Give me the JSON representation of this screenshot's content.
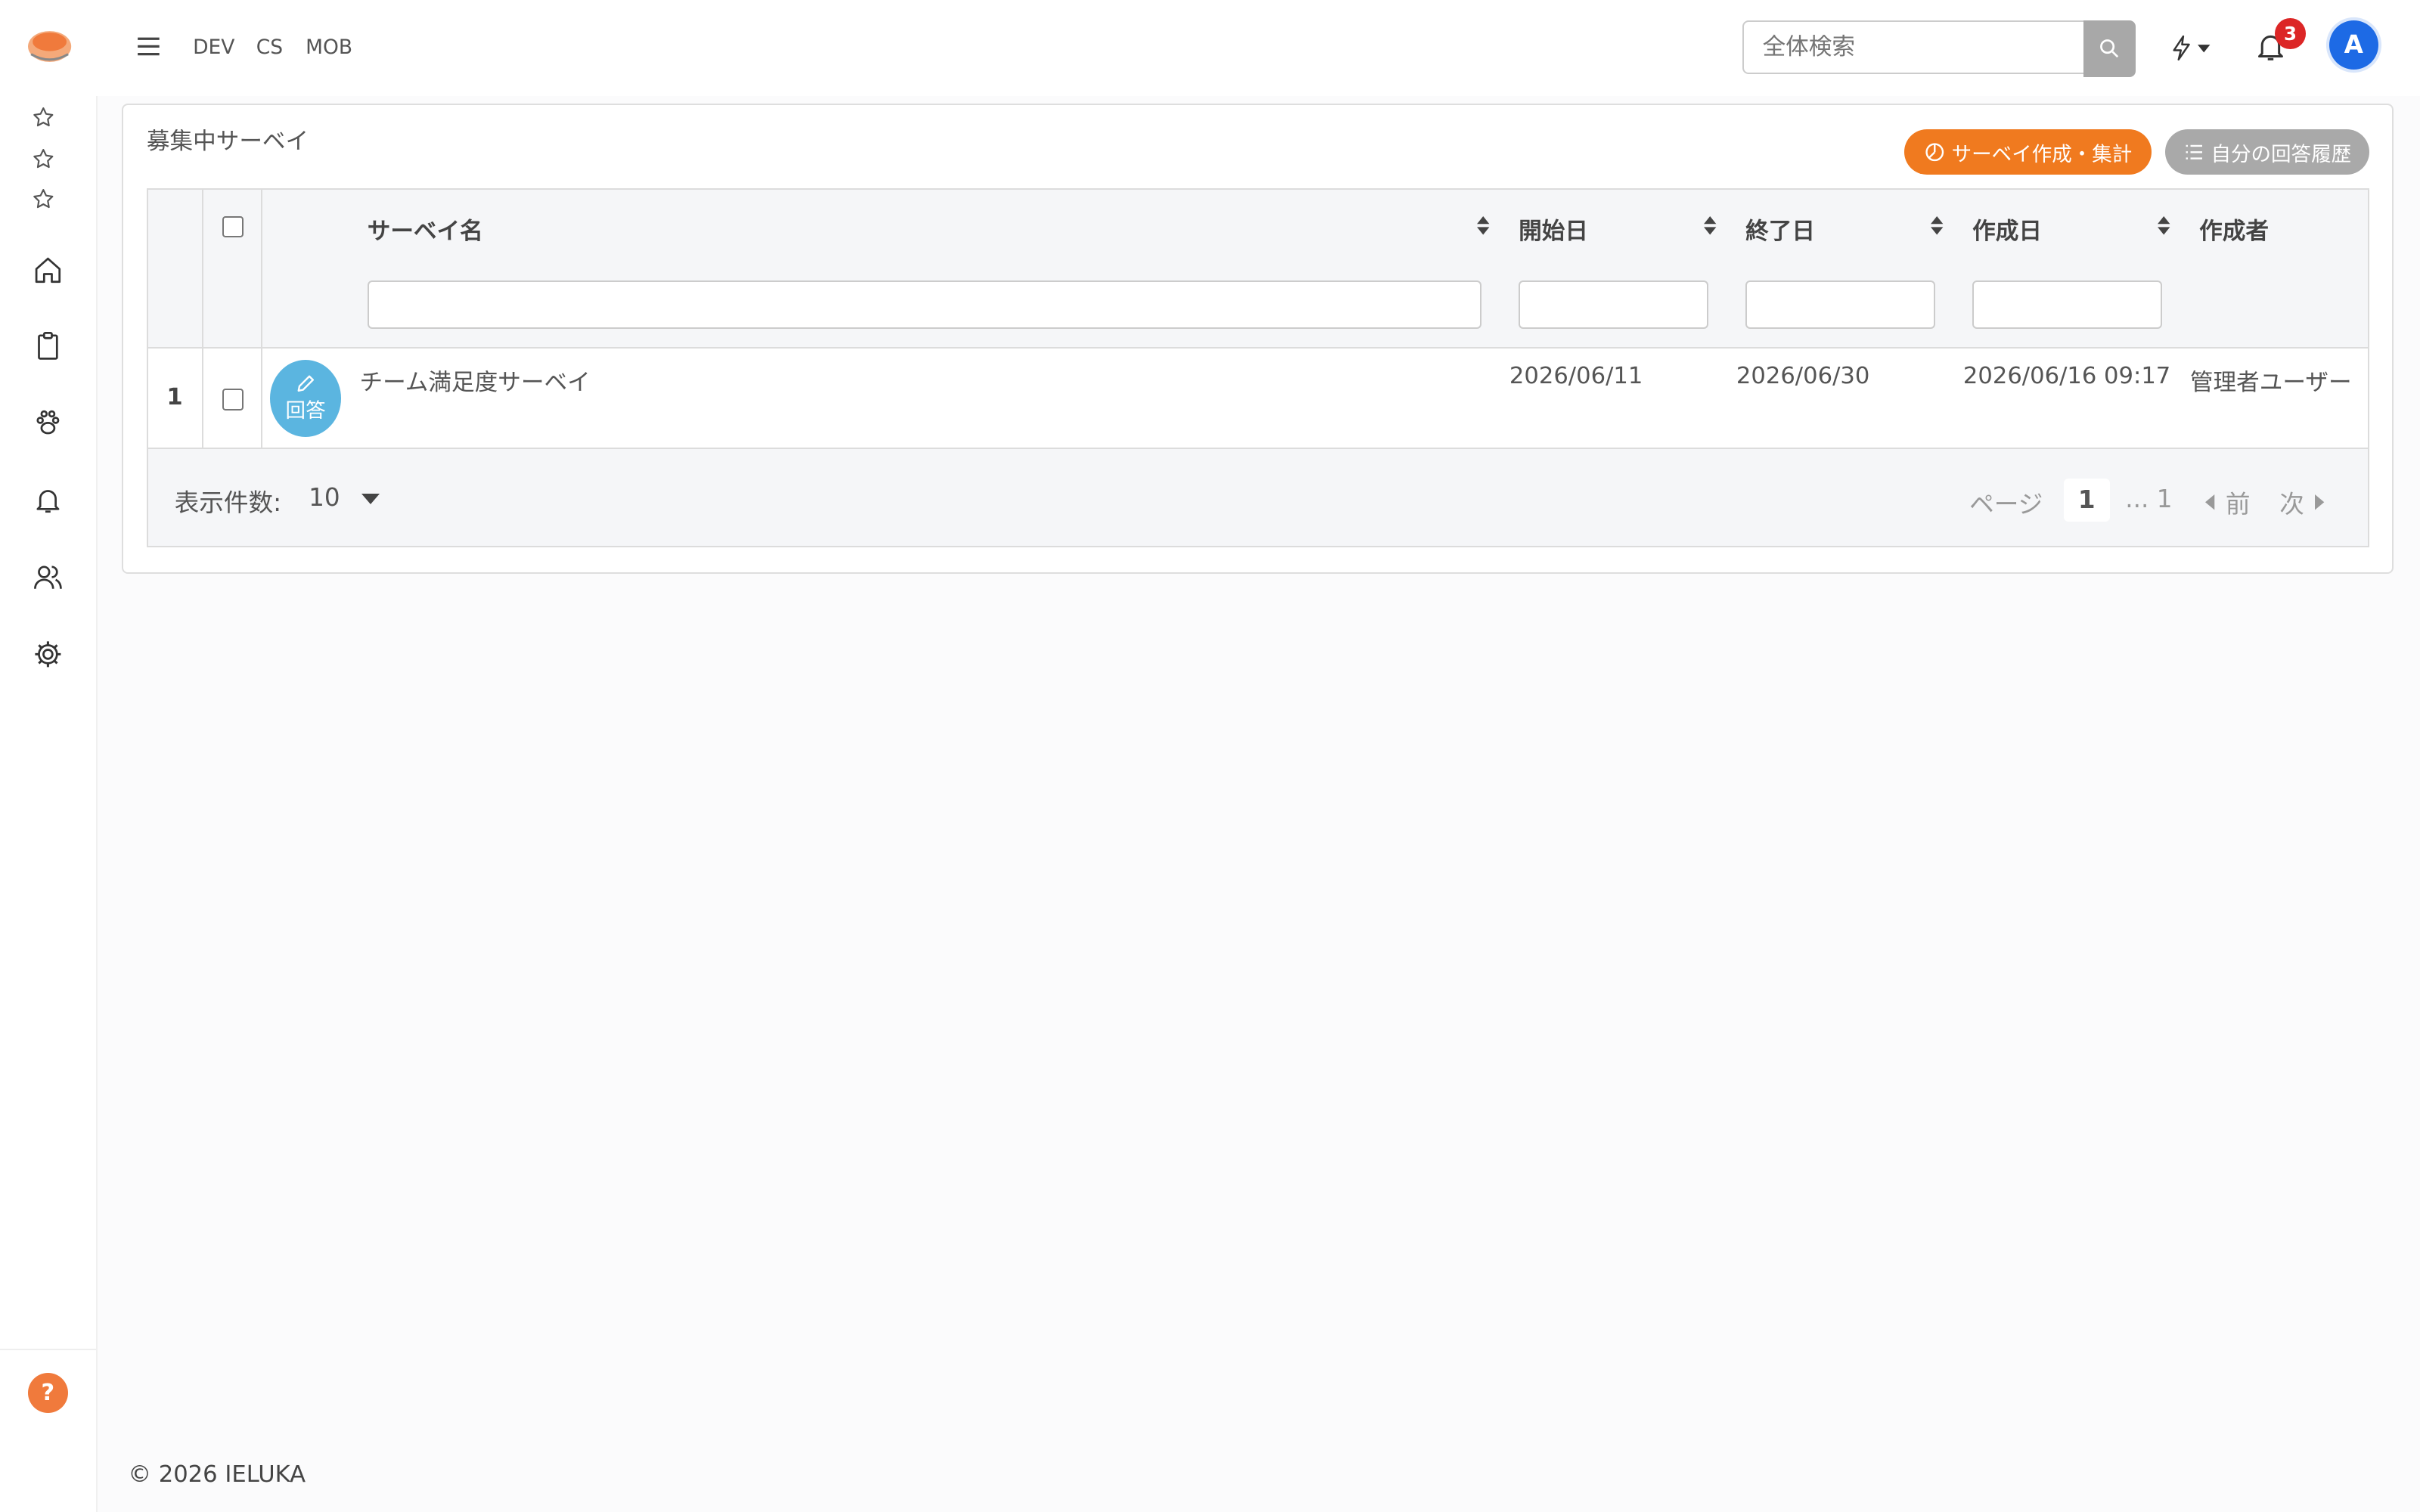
{
  "topbar": {
    "env_links": [
      "DEV",
      "CS",
      "MOB"
    ],
    "search_placeholder": "全体検索",
    "notification_count": "3",
    "avatar_initial": "A"
  },
  "page": {
    "title": "募集中サーベイ",
    "create_button": "サーベイ作成・集計",
    "history_button": "自分の回答履歴"
  },
  "table": {
    "columns": [
      "サーベイ名",
      "開始日",
      "終了日",
      "作成日",
      "作成者"
    ],
    "rows": [
      {
        "index": "1",
        "action_label": "回答",
        "name": "チーム満足度サーベイ",
        "start": "2026/06/11",
        "end": "2026/06/30",
        "created": "2026/06/16 09:17",
        "author": "管理者ユーザー"
      }
    ],
    "per_page_label": "表示件数:",
    "per_page_value": "10",
    "page_label": "ページ",
    "current_page": "1",
    "total_pages": "... 1",
    "prev_label": "前",
    "next_label": "次"
  },
  "footer": {
    "copyright": "© 2026 IELUKA"
  },
  "colors": {
    "accent_orange": "#f07a1f",
    "avatar_blue": "#1d6ae5",
    "answer_button": "#5bb5e0",
    "badge_red": "#dc2626"
  }
}
